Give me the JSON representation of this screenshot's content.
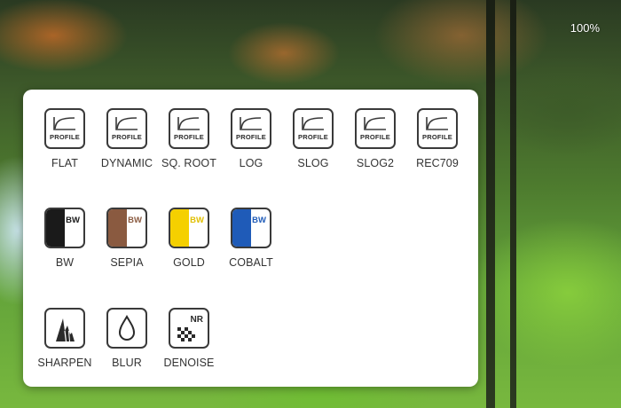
{
  "status": {
    "battery": "100%"
  },
  "profiles": [
    {
      "label": "FLAT",
      "badge": "PROFILE",
      "icon": "profile-curve-icon"
    },
    {
      "label": "DYNAMIC",
      "badge": "PROFILE",
      "icon": "profile-curve-icon"
    },
    {
      "label": "SQ. ROOT",
      "badge": "PROFILE",
      "icon": "profile-curve-icon"
    },
    {
      "label": "LOG",
      "badge": "PROFILE",
      "icon": "profile-curve-icon"
    },
    {
      "label": "SLOG",
      "badge": "PROFILE",
      "icon": "profile-curve-icon"
    },
    {
      "label": "SLOG2",
      "badge": "PROFILE",
      "icon": "profile-curve-icon"
    },
    {
      "label": "REC709",
      "badge": "PROFILE",
      "icon": "profile-curve-icon"
    }
  ],
  "tints": [
    {
      "label": "BW",
      "badge": "BW",
      "color": "#1a1a1a",
      "badge_color": "#1a1a1a",
      "icon": "bw-tint-icon"
    },
    {
      "label": "SEPIA",
      "badge": "BW",
      "color": "#8a5a40",
      "badge_color": "#8a5a40",
      "icon": "sepia-tint-icon"
    },
    {
      "label": "GOLD",
      "badge": "BW",
      "color": "#f5d000",
      "badge_color": "#e0bf00",
      "icon": "gold-tint-icon"
    },
    {
      "label": "COBALT",
      "badge": "BW",
      "color": "#1f5bb8",
      "badge_color": "#1f5bb8",
      "icon": "cobalt-tint-icon"
    }
  ],
  "filters": [
    {
      "label": "SHARPEN",
      "icon": "sharpen-icon"
    },
    {
      "label": "BLUR",
      "icon": "blur-drop-icon"
    },
    {
      "label": "DENOISE",
      "icon": "denoise-icon",
      "badge": "NR"
    }
  ]
}
